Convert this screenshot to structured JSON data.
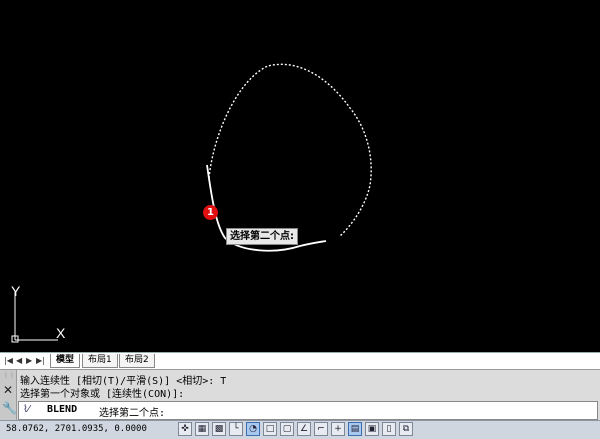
{
  "canvas": {
    "tooltip": "选择第二个点:",
    "marker_label": "1",
    "ucs_x_label": "X",
    "ucs_y_label": "Y"
  },
  "layout_tabs": {
    "nav_buttons": [
      "|◀",
      "◀",
      "▶",
      "▶|"
    ],
    "tabs": [
      "模型",
      "布局1",
      "布局2"
    ],
    "active": "模型"
  },
  "command_line": {
    "history": [
      "输入连续性 [相切(T)/平滑(S)] <相切>: T",
      "选择第一个对象或 [连续性(CON)]:"
    ],
    "command": "BLEND",
    "prompt": "选择第二个点:"
  },
  "status_bar": {
    "coordinates": "58.0762,  2701.0935, 0.0000",
    "toggles": [
      {
        "icon": "infer-constraints-icon",
        "glyph": "✜",
        "on": false
      },
      {
        "icon": "snap-mode-icon",
        "glyph": "▦",
        "on": false
      },
      {
        "icon": "grid-display-icon",
        "glyph": "▩",
        "on": false
      },
      {
        "icon": "ortho-mode-icon",
        "glyph": "└",
        "on": false
      },
      {
        "icon": "polar-tracking-icon",
        "glyph": "◔",
        "on": true
      },
      {
        "icon": "object-snap-icon",
        "glyph": "□",
        "on": false
      },
      {
        "icon": "3d-object-snap-icon",
        "glyph": "▢",
        "on": false
      },
      {
        "icon": "object-snap-tracking-icon",
        "glyph": "∠",
        "on": false
      },
      {
        "icon": "allow-dynamic-ucs-icon",
        "glyph": "⌐",
        "on": false
      },
      {
        "icon": "dynamic-input-icon",
        "glyph": "+",
        "on": false
      },
      {
        "icon": "lineweight-icon",
        "glyph": "▤",
        "on": true
      },
      {
        "icon": "transparency-icon",
        "glyph": "▣",
        "on": false
      },
      {
        "icon": "quick-properties-icon",
        "glyph": "▯",
        "on": false
      },
      {
        "icon": "selection-cycling-icon",
        "glyph": "⧉",
        "on": false
      }
    ]
  }
}
